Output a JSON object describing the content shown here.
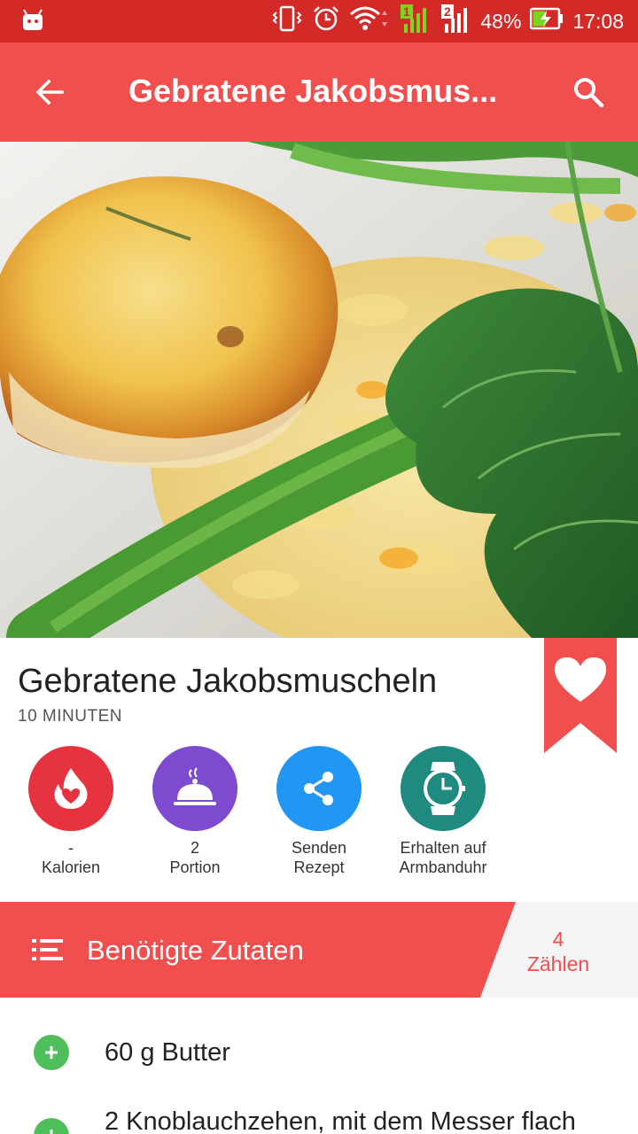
{
  "status_bar": {
    "battery": "48%",
    "time": "17:08",
    "sim1": "1",
    "sim2": "2"
  },
  "app_bar": {
    "title": "Gebratene Jakobsmus...",
    "back_icon": "arrow-left-icon",
    "search_icon": "search-icon"
  },
  "recipe": {
    "title": "Gebratene Jakobsmuscheln",
    "duration": "10 MINUTEN",
    "favorite_icon": "heart-bookmark-icon"
  },
  "actions": [
    {
      "icon": "flame-heart-icon",
      "line1": "-",
      "line2": "Kalorien",
      "color": "#e5343f"
    },
    {
      "icon": "cloche-icon",
      "line1": "2",
      "line2": "Portion",
      "color": "#7e4bd0"
    },
    {
      "icon": "share-icon",
      "line1": "Senden",
      "line2": "Rezept",
      "color": "#2196f3"
    },
    {
      "icon": "watch-icon",
      "line1": "Erhalten auf",
      "line2": "Armbanduhr",
      "color": "#1f8a80"
    }
  ],
  "ingredients_header": {
    "title": "Benötigte Zutaten",
    "count_value": "4",
    "count_label": "Zählen"
  },
  "ingredients": [
    {
      "text": "60 g Butter"
    },
    {
      "text": "2 Knoblauchzehen, mit dem Messer flach"
    }
  ],
  "colors": {
    "primary": "#f14e4e",
    "status_bar": "#d42a27",
    "add_green": "#4fbf5b"
  }
}
